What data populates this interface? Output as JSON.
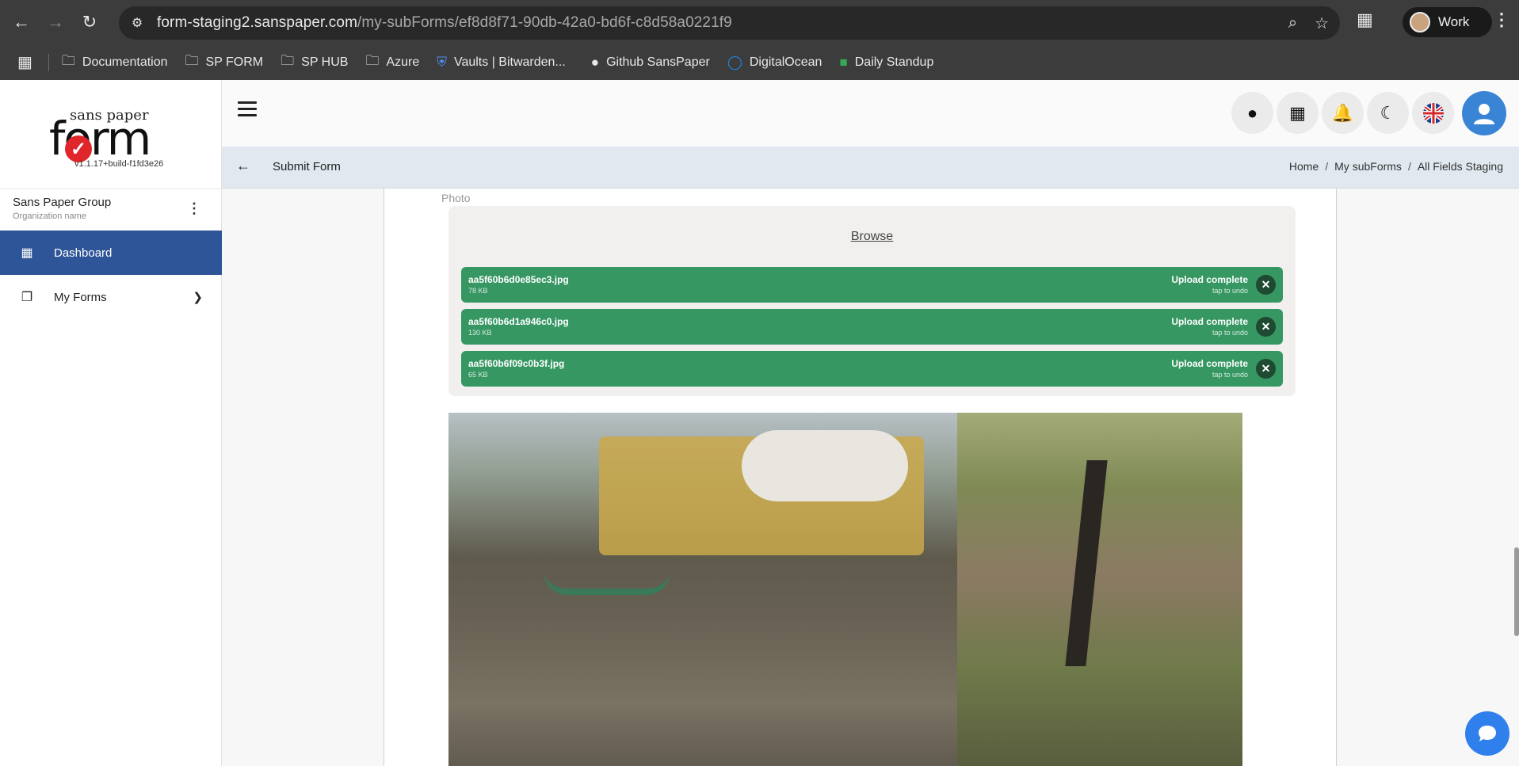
{
  "browser": {
    "url_host": "form-staging2.sanspaper.com",
    "url_path": "/my-subForms/ef8d8f71-90db-42a0-bd6f-c8d58a0221f9",
    "profile_name": "Work",
    "bookmarks": [
      {
        "label": "Documentation",
        "icon": "folder-icon"
      },
      {
        "label": "SP FORM",
        "icon": "folder-icon"
      },
      {
        "label": "SP HUB",
        "icon": "folder-icon"
      },
      {
        "label": "Azure",
        "icon": "folder-icon"
      },
      {
        "label": "Vaults | Bitwarden...",
        "icon": "bitwarden-icon"
      },
      {
        "label": "Github SansPaper",
        "icon": "github-icon"
      },
      {
        "label": "DigitalOcean",
        "icon": "digitalocean-icon"
      },
      {
        "label": "Daily Standup",
        "icon": "meet-icon"
      }
    ]
  },
  "app": {
    "logo": {
      "tagline": "sans paper",
      "wordmark": "form",
      "version": "v1.1.17+build-f1fd3e26"
    },
    "org": {
      "name": "Sans Paper Group",
      "subtitle": "Organization name"
    },
    "sidebar": [
      {
        "label": "Dashboard",
        "icon": "dashboard-grid-icon",
        "active": true
      },
      {
        "label": "My Forms",
        "icon": "documents-icon",
        "active": false
      }
    ],
    "page_title": "Submit Form",
    "breadcrumbs": [
      "Home",
      "My subForms",
      "All Fields Staging"
    ],
    "colors": {
      "primary": "#2d5597",
      "upload_success": "#369763",
      "fab": "#2f80ed"
    }
  },
  "form": {
    "field_label": "Photo",
    "browse_label": "Browse",
    "files": [
      {
        "name": "aa5f60b6d0e85ec3.jpg",
        "size": "78 KB",
        "status": "Upload complete",
        "undo": "tap to undo"
      },
      {
        "name": "aa5f60b6d1a946c0.jpg",
        "size": "130 KB",
        "status": "Upload complete",
        "undo": "tap to undo"
      },
      {
        "name": "aa5f60b6f09c0b3f.jpg",
        "size": "65 KB",
        "status": "Upload complete",
        "undo": "tap to undo"
      }
    ]
  }
}
